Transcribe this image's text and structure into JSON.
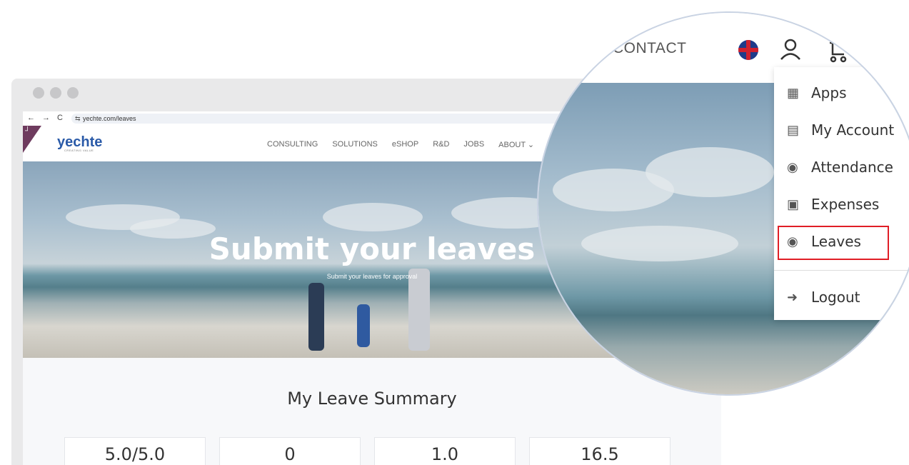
{
  "browser": {
    "nav": {
      "back": "←",
      "forward": "→",
      "reload": "C"
    },
    "url": "yechte.com/leaves"
  },
  "site": {
    "logo": "yechte",
    "tagline": "CREATING VALUE",
    "menu": [
      "CONSULTING",
      "SOLUTIONS",
      "eSHOP",
      "R&D",
      "JOBS",
      "ABOUT ⌄"
    ],
    "hero_title": "Submit your leaves",
    "hero_subtitle": "Submit your leaves for approval",
    "summary_title": "My Leave Summary",
    "cards": [
      "5.0/5.0",
      "0",
      "1.0",
      "16.5"
    ]
  },
  "zoom": {
    "contact": "CONTACT",
    "dropdown": [
      {
        "icon": "apps-grid-icon",
        "label": "Apps"
      },
      {
        "icon": "id-card-icon",
        "label": "My Account"
      },
      {
        "icon": "user-circle-icon",
        "label": "Attendance"
      },
      {
        "icon": "money-icon",
        "label": "Expenses"
      },
      {
        "icon": "user-circle-icon",
        "label": "Leaves"
      },
      {
        "icon": "logout-icon",
        "label": "Logout"
      }
    ],
    "highlight_color": "#e01e26"
  }
}
